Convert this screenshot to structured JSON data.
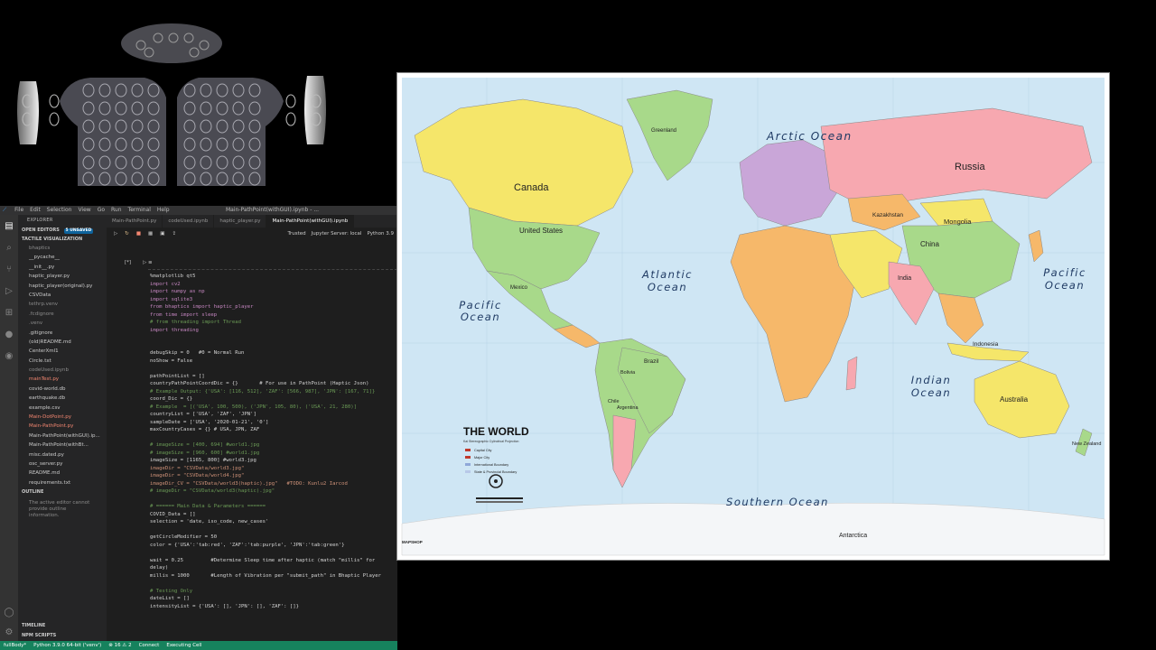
{
  "haptic": {
    "label": "haptic vest visualization"
  },
  "vscode": {
    "menu": [
      "File",
      "Edit",
      "Selection",
      "View",
      "Go",
      "Run",
      "Terminal",
      "Help"
    ],
    "window_title": "Main-PathPoint(withGUI).ipynb - ...",
    "sidebar": {
      "explorer": "EXPLORER",
      "open_editors": "OPEN EDITORS",
      "unsaved_badge": "5 UNSAVED",
      "project": "TACTILE VISUALIZATION",
      "files": [
        {
          "name": "bhaptics",
          "cls": "gray"
        },
        {
          "name": "__pycache__",
          "cls": ""
        },
        {
          "name": "__init__.py",
          "cls": ""
        },
        {
          "name": "haptic_player.py",
          "cls": ""
        },
        {
          "name": "haptic_player(original).py",
          "cls": ""
        },
        {
          "name": "CSVData",
          "cls": ""
        },
        {
          "name": "tethrp.venv",
          "cls": "gray"
        },
        {
          "name": ".fcdignore",
          "cls": "gray"
        },
        {
          "name": ".venv",
          "cls": "gray"
        },
        {
          "name": ".gitignore",
          "cls": ""
        },
        {
          "name": "(old)README.md",
          "cls": ""
        },
        {
          "name": "CenterXml1",
          "cls": ""
        },
        {
          "name": "Circle.txt",
          "cls": ""
        },
        {
          "name": "codeUsed.ipynb",
          "cls": "gray"
        },
        {
          "name": "mainTest.py",
          "cls": "err"
        },
        {
          "name": "covid-world.db",
          "cls": ""
        },
        {
          "name": "earthquake.db",
          "cls": ""
        },
        {
          "name": "example.csv",
          "cls": ""
        },
        {
          "name": "Main-DotPoint.py",
          "cls": "err"
        },
        {
          "name": "Main-PathPoint.py",
          "cls": "err"
        },
        {
          "name": "Main-PathPoint(withGUI).ip...",
          "cls": ""
        },
        {
          "name": "Main-PathPoint(withBt...",
          "cls": ""
        },
        {
          "name": "misc.dated.py",
          "cls": ""
        },
        {
          "name": "osc_server.py",
          "cls": ""
        },
        {
          "name": "README.md",
          "cls": ""
        },
        {
          "name": "requirements.txt",
          "cls": ""
        }
      ],
      "outline": "OUTLINE",
      "outline_msg": "The active editor cannot provide outline information.",
      "timeline": "TIMELINE",
      "npm": "NPM SCRIPTS"
    },
    "tabs": [
      "Main-PathPoint.py",
      "codeUsed.ipynb",
      "haptic_player.py",
      "Main-PathPoint(withGUI).ipynb"
    ],
    "toolbar": {
      "trusted": "Trusted",
      "server": "Jupyter Server: local",
      "kernel": "Python 3.9"
    },
    "cell_label": "[*]",
    "code_lines": [
      {
        "t": "%matplotlib qt5",
        "c": ""
      },
      {
        "t": "import cv2",
        "c": "kw"
      },
      {
        "t": "import numpy as np",
        "c": "kw"
      },
      {
        "t": "import sqlite3",
        "c": "kw"
      },
      {
        "t": "from bhaptics import haptic_player",
        "c": "kw"
      },
      {
        "t": "from time import sleep",
        "c": "kw"
      },
      {
        "t": "# from threading import Thread",
        "c": "cm"
      },
      {
        "t": "import threading",
        "c": "kw"
      },
      {
        "t": "",
        "c": ""
      },
      {
        "t": "",
        "c": ""
      },
      {
        "t": "debugSkip = 0   #0 = Normal Run",
        "c": ""
      },
      {
        "t": "noShow = False",
        "c": ""
      },
      {
        "t": "",
        "c": ""
      },
      {
        "t": "pathPointList = []",
        "c": ""
      },
      {
        "t": "countryPathPointCoordDic = {}       # For use in PathPoint (Haptic Json)",
        "c": ""
      },
      {
        "t": "# Example Output: {'USA': [116, 512], 'ZAF': [566, 987], 'JPN': [167, 71]}",
        "c": "cm"
      },
      {
        "t": "coord_Dic = {}",
        "c": ""
      },
      {
        "t": "# Example  = [('USA', 100, 500), ('JPN', 105, 80), ('USA', 21, 280)]",
        "c": "cm"
      },
      {
        "t": "countryList = ['USA', 'ZAF', 'JPN']",
        "c": ""
      },
      {
        "t": "sampleDate = ['USA', '2020-01-21', '0']",
        "c": ""
      },
      {
        "t": "maxCountryCases = {} # USA, JPN, ZAF",
        "c": ""
      },
      {
        "t": "",
        "c": ""
      },
      {
        "t": "# imageSize = [400, 694] #world1.jpg",
        "c": "cm"
      },
      {
        "t": "# imageSize = [960, 600] #world1.jpg",
        "c": "cm"
      },
      {
        "t": "imageSize = [1165, 800] #world3.jpg",
        "c": ""
      },
      {
        "t": "imageDir = \"CSVData/world3.jpg\"",
        "c": "st"
      },
      {
        "t": "imageDir = \"CSVData/world4.jpg\"",
        "c": "st"
      },
      {
        "t": "imageDir_CV = \"CSVData/world3(haptic).jpg\"   #TODO: Kunlu2 Iarcod",
        "c": "st"
      },
      {
        "t": "# imageDir = \"CSVData/world3(haptic).jpg\"",
        "c": "cm"
      },
      {
        "t": "",
        "c": ""
      },
      {
        "t": "# ====== Main Data & Parameters ======",
        "c": "cm"
      },
      {
        "t": "COVID_Data = []",
        "c": ""
      },
      {
        "t": "selection = 'date, iso_code, new_cases'",
        "c": ""
      },
      {
        "t": "",
        "c": ""
      },
      {
        "t": "getCircleModifier = 50",
        "c": ""
      },
      {
        "t": "color = {'USA':'tab:red', 'ZAF':'tab:purple', 'JPN':'tab:green'}",
        "c": ""
      },
      {
        "t": "",
        "c": ""
      },
      {
        "t": "wait = 0.25         #Determine Sleep time after haptic (match \"millis\" for",
        "c": ""
      },
      {
        "t": "delay)",
        "c": ""
      },
      {
        "t": "millis = 1000       #Length of Vibration per \"submit_path\" in Bhaptic Player",
        "c": ""
      },
      {
        "t": "",
        "c": ""
      },
      {
        "t": "# Testing Only",
        "c": "cm"
      },
      {
        "t": "dateList = []",
        "c": ""
      },
      {
        "t": "intensityList = {'USA': [], 'JPN': [], 'ZAF': []}",
        "c": ""
      }
    ],
    "status": {
      "branch": "fullBody*",
      "python": "Python 3.9.0 64-bit ('venv')",
      "errors": "⊗ 16 ⚠ 2",
      "connect": "Connect",
      "exec": "Executing Cell"
    }
  },
  "map": {
    "title": "THE WORLD",
    "subtitle": "Kai Stereographic Cylindrical Projection",
    "legend": [
      "Capital City",
      "Major City",
      "International Boundary",
      "State & Provincial Boundary"
    ],
    "publisher": "MAPSHOP",
    "oceans": {
      "arctic": "Arctic Ocean",
      "atlantic1": "Atlantic",
      "atlantic2": "Ocean",
      "pacific_w1": "Pacific",
      "pacific_w2": "Ocean",
      "pacific_e1": "Pacific",
      "pacific_e2": "Ocean",
      "indian1": "Indian",
      "indian2": "Ocean",
      "southern": "Southern Ocean"
    },
    "labels": {
      "canada": "Canada",
      "greenland": "Greenland",
      "usa": "United States",
      "russia": "Russia",
      "kazakhstan": "Kazakhstan",
      "mongolia": "Mongolia",
      "china": "China",
      "india": "India",
      "brazil": "Brazil",
      "australia": "Australia",
      "indonesia": "Indonesia",
      "antarctica": "Antarctica",
      "nz": "New Zealand",
      "argentina": "Argentina",
      "bolivia": "Bolivia",
      "chile": "Chile",
      "mexico": "Mexico"
    },
    "colors": {
      "ocean": "#cfe6f4",
      "land_yellow": "#f5e66a",
      "land_pink": "#f7a8b0",
      "land_green": "#a8d98a",
      "land_orange": "#f6b86a",
      "land_purple": "#c9a6d8",
      "ice": "#f4f6f8"
    }
  }
}
